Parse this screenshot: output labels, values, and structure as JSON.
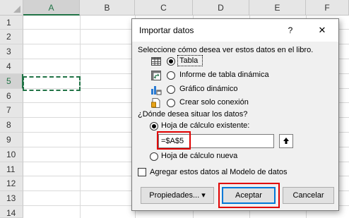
{
  "sheet": {
    "columns": [
      "A",
      "B",
      "C",
      "D",
      "E",
      "F"
    ],
    "rows": [
      "1",
      "2",
      "3",
      "4",
      "5",
      "6",
      "7",
      "8",
      "9",
      "10",
      "11",
      "12",
      "13",
      "14"
    ],
    "active_column": "A",
    "active_row": "5"
  },
  "dialog": {
    "title": "Importar datos",
    "help_glyph": "?",
    "close_glyph": "✕",
    "view_prompt": "Seleccione cómo desea ver estos datos en el libro.",
    "view_options": [
      {
        "label": "Tabla",
        "selected": true,
        "icon": "table-icon"
      },
      {
        "label": "Informe de tabla dinámica",
        "selected": false,
        "icon": "pivot-table-icon"
      },
      {
        "label": "Gráfico dinámico",
        "selected": false,
        "icon": "pivot-chart-icon"
      },
      {
        "label": "Crear solo conexión",
        "selected": false,
        "icon": "connection-icon"
      }
    ],
    "location_prompt": "¿Dónde desea situar los datos?",
    "location_options": [
      {
        "label": "Hoja de cálculo existente:",
        "selected": true
      },
      {
        "label": "Hoja de cálculo nueva",
        "selected": false
      }
    ],
    "cell_reference": "=$A$5",
    "data_model_label": "Agregar estos datos al Modelo de datos",
    "data_model_checked": false,
    "buttons": {
      "properties": "Propiedades...",
      "properties_arrow": "▾",
      "accept": "Aceptar",
      "cancel": "Cancelar"
    }
  },
  "colors": {
    "excel_green": "#217346",
    "highlight_red": "#e00000",
    "dialog_bg": "#f0f0f0",
    "default_button_border": "#0078d7"
  }
}
